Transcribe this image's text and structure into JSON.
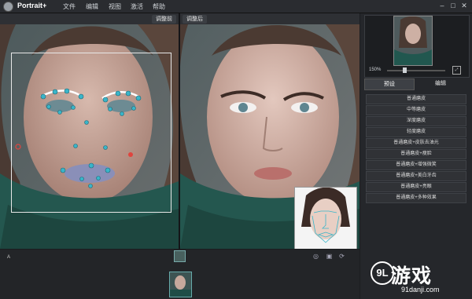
{
  "app": {
    "title": "Portrait+"
  },
  "menu": [
    "文件",
    "编辑",
    "视图",
    "激活",
    "帮助"
  ],
  "window_controls": [
    "–",
    "□",
    "✕"
  ],
  "views": {
    "before_label": "调整前",
    "after_label": "调整后"
  },
  "navigator": {
    "zoom_label": "150%",
    "zoom_level": 0.3,
    "fit_icon": "fit-icon"
  },
  "tabs": {
    "preset": "预设",
    "edit": "编辑",
    "active": "preset"
  },
  "presets": [
    "普通磨皮",
    "中等磨皮",
    "深度磨皮",
    "轻度磨皮",
    "普通磨皮+皮肤去油光",
    "普通磨皮+瘦脸",
    "普通磨皮+增强微笑",
    "普通磨皮+美白牙齿",
    "普通磨皮+亮眼",
    "普通磨皮+多种效果"
  ],
  "bottom": {
    "marker": "A"
  },
  "watermark": {
    "logo": "9L",
    "text": "游戏",
    "url": "91danji.com"
  },
  "colors": {
    "accent_landmark": "#39b5c9",
    "red_landmark": "#e0443e",
    "background": "#1b1d20"
  }
}
